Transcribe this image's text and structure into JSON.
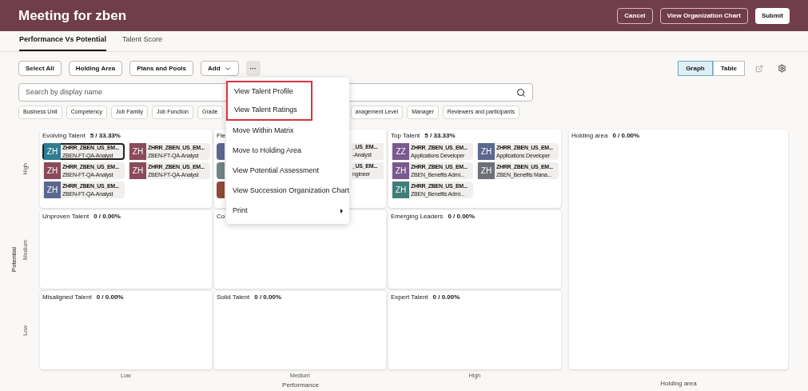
{
  "header": {
    "title": "Meeting for zben",
    "buttons": [
      {
        "label": "Cancel",
        "kind": "outline"
      },
      {
        "label": "View Organization Chart",
        "kind": "outline"
      },
      {
        "label": "Submit",
        "kind": "primary"
      }
    ]
  },
  "tabs": [
    {
      "label": "Performance Vs Potential",
      "selected": true
    },
    {
      "label": "Talent Score",
      "selected": false
    }
  ],
  "toolbar": {
    "buttons": [
      {
        "label": "Select All",
        "kind": "plain"
      },
      {
        "label": "Holding Area",
        "kind": "plain"
      },
      {
        "label": "Plans and Pools",
        "kind": "plain"
      },
      {
        "label": "Add",
        "kind": "dropdown"
      },
      {
        "label": "···",
        "kind": "more"
      }
    ],
    "views": [
      {
        "label": "Graph",
        "selected": true
      },
      {
        "label": "Table",
        "selected": false
      }
    ]
  },
  "search": {
    "placeholder": "Search by display name"
  },
  "filters_left": [
    "Business Unit",
    "Competency",
    "Job Family",
    "Job Function",
    "Grade"
  ],
  "filters_right": [
    "anagement Level",
    "Manager",
    "Reviewers and participants"
  ],
  "matrix": {
    "y_title": "Potential",
    "x_title": "Performance",
    "rows": [
      "High",
      "Medium",
      "Low"
    ],
    "columns": [
      "Low",
      "Medium",
      "High"
    ],
    "cells": [
      {
        "kind": "full",
        "title": "Evolving Talent",
        "count": "5 / 33.33%",
        "cards": [
          {
            "initials": "ZH",
            "name": "ZHRR_ZBEN_US_EM...",
            "role": "ZBEN-FT-QA-Analyst",
            "color": "#2f7d92",
            "selected": true
          },
          {
            "initials": "ZH",
            "name": "ZHRR_ZBEN_US_EM...",
            "role": "ZBEN-FT-QA-Analyst",
            "color": "#8b4a5c",
            "selected": false
          },
          {
            "initials": "ZH",
            "name": "ZHRR_ZBEN_US_EM...",
            "role": "ZBEN-FT-QA-Analyst",
            "color": "#8b4a5c",
            "selected": false
          },
          {
            "initials": "ZH",
            "name": "ZHRR_ZBEN_US_EM...",
            "role": "ZBEN-FT-QA-Analyst",
            "color": "#8b4a5c",
            "selected": false
          },
          {
            "initials": "ZH",
            "name": "ZHRR_ZBEN_US_EM...",
            "role": "ZBEN-FT-QA-Analyst",
            "color": "#5a6890",
            "selected": false
          }
        ]
      },
      {
        "kind": "partial",
        "title": "Fle",
        "fragments": [
          {
            "color": "#5a6890",
            "name": "_US_EM...",
            "role": "-Analyst"
          },
          {
            "color": "#6f8583",
            "name": "_US_EM...",
            "role": "ngineer"
          },
          {
            "color": "#8e4a36"
          }
        ]
      },
      {
        "kind": "full",
        "title": "Top Talent",
        "count": "5 / 33.33%",
        "cards": [
          {
            "initials": "ZZ",
            "name": "ZHRR_ZBEN_US_EM...",
            "role": "Applications Developer",
            "color": "#7a5a8e",
            "selected": false
          },
          {
            "initials": "ZH",
            "name": "ZHRR_ZBEN_US_EM...",
            "role": "Applications Developer",
            "color": "#5a6890",
            "selected": false
          },
          {
            "initials": "ZH",
            "name": "ZHRR_ZBEN_US_EM...",
            "role": "ZBEN_Benefits Admi...",
            "color": "#7a5a8e",
            "selected": false
          },
          {
            "initials": "ZH",
            "name": "ZHRR_ZBEN_US_EM...",
            "role": "ZBEN_Benefits Mana...",
            "color": "#6d7077",
            "selected": false
          },
          {
            "initials": "ZH",
            "name": "ZHRR_ZBEN_US_EM...",
            "role": "ZBEN_Benefits Admi...",
            "color": "#3f7f78",
            "selected": false
          }
        ]
      },
      {
        "kind": "full",
        "title": "Unproven Talent",
        "count": "0 / 0.00%"
      },
      {
        "kind": "partial",
        "title": "Co"
      },
      {
        "kind": "full",
        "title": "Emerging Leaders",
        "count": "0 / 0.00%"
      },
      {
        "kind": "full",
        "title": "Misaligned Talent",
        "count": "0 / 0.00%"
      },
      {
        "kind": "full",
        "title": "Solid Talent",
        "count": "0 / 0.00%"
      },
      {
        "kind": "full",
        "title": "Expert Talent",
        "count": "0 / 0.00%"
      }
    ]
  },
  "holding": {
    "title": "Holding area",
    "count": "0 / 0.00%",
    "label": "Holding area"
  },
  "menu": {
    "items": [
      {
        "label": "View Talent Profile",
        "outlined": true,
        "submenu": false
      },
      {
        "label": "View Talent Ratings",
        "outlined": true,
        "submenu": false
      },
      {
        "label": "Move Within Matrix",
        "outlined": false,
        "submenu": false
      },
      {
        "label": "Move to Holding Area",
        "outlined": false,
        "submenu": false
      },
      {
        "label": "View Potential Assessment",
        "outlined": false,
        "submenu": false
      },
      {
        "label": "View Succession Organization Chart",
        "outlined": false,
        "submenu": false
      },
      {
        "label": "Print",
        "outlined": false,
        "submenu": true
      }
    ]
  }
}
